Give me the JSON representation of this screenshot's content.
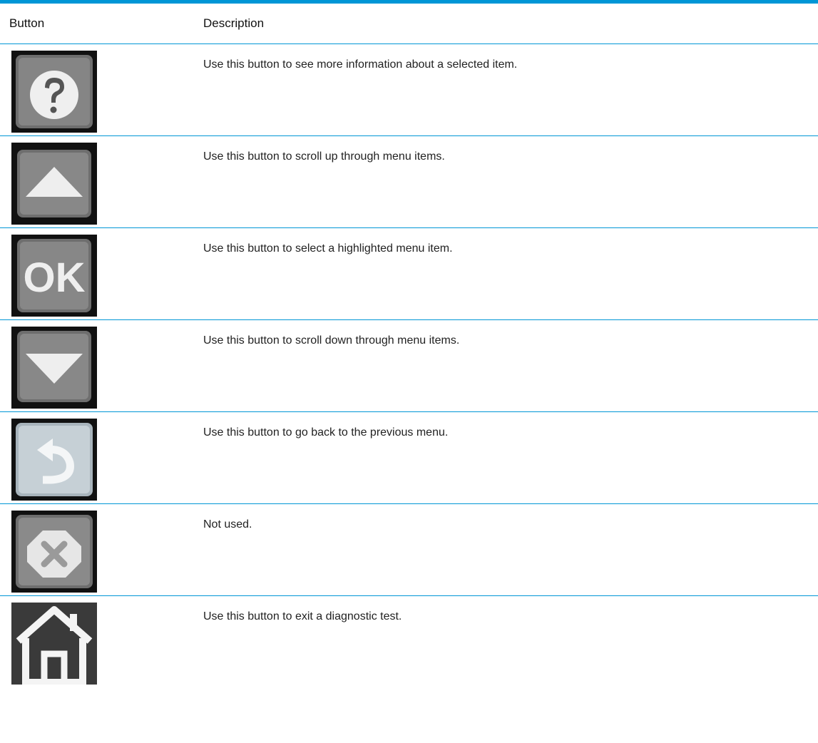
{
  "table": {
    "headers": {
      "button": "Button",
      "description": "Description"
    },
    "rows": [
      {
        "icon": "help-icon",
        "description": "Use this button to see more information about a selected item."
      },
      {
        "icon": "up-arrow-icon",
        "description": "Use this button to scroll up through menu items."
      },
      {
        "icon": "ok-icon",
        "description": "Use this button to select a highlighted menu item."
      },
      {
        "icon": "down-arrow-icon",
        "description": "Use this button to scroll down through menu items."
      },
      {
        "icon": "back-icon",
        "description": "Use this button to go back to the previous menu."
      },
      {
        "icon": "cancel-icon",
        "description": "Not used."
      },
      {
        "icon": "home-icon",
        "description": "Use this button to exit a diagnostic test."
      }
    ]
  },
  "colors": {
    "rule": "#0096d6",
    "button_face": "#7d7d7d",
    "button_frame": "#1a1a1a"
  }
}
